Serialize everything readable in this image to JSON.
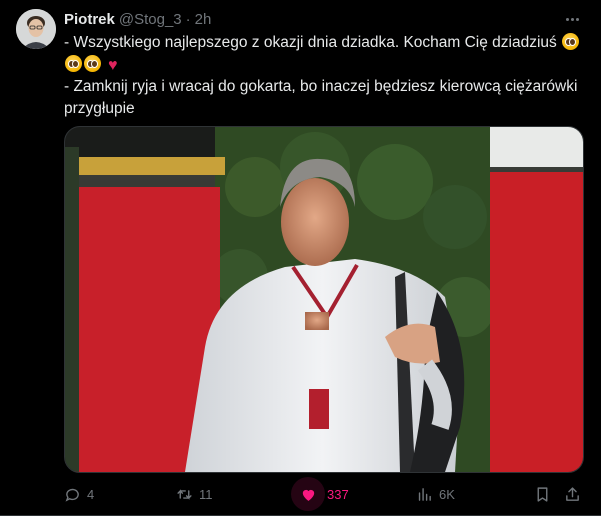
{
  "author": {
    "name": "Piotrek",
    "handle": "@Stog_3",
    "separator": "·",
    "time": "2h"
  },
  "tweet": {
    "line1": "- Wszystkiego najlepszego z okazji dnia dziadka. Kocham Cię dziadziuś",
    "line2": "- Zamknij ryja i wracaj do gokarta, bo inaczej będziesz kierowcą ciężarówki przygłupie"
  },
  "stats": {
    "replies": "4",
    "retweets": "11",
    "likes": "337",
    "views": "6K"
  },
  "colors": {
    "background": "#000000",
    "text": "#e7e9ea",
    "muted": "#71767b",
    "like": "#f91880",
    "border": "#2f3336"
  },
  "icons": [
    "more-icon",
    "pleading-face-emoji",
    "red-heart-emoji",
    "reply-icon",
    "retweet-icon",
    "like-icon",
    "views-icon",
    "bookmark-icon",
    "share-icon"
  ]
}
